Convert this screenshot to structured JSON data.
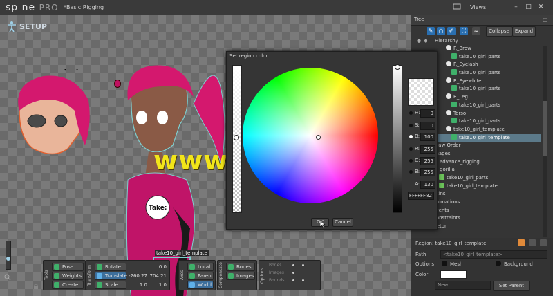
{
  "app": {
    "logo_main": "sp ne",
    "logo_pro": "PRO",
    "project": "*Basic Rigging",
    "views_label": "Views"
  },
  "viewport": {
    "mode_label": "SETUP",
    "name_tag": "take10_girl_template",
    "shirt_text": "Take:"
  },
  "tree": {
    "title": "Tree",
    "collapse_label": "Collapse",
    "expand_label": "Expand",
    "hierarchy_label": "Hierarchy",
    "rows": [
      {
        "label": "R_Brow",
        "indent": 50,
        "icon": "bone"
      },
      {
        "label": "take10_girl_parts",
        "indent": 58,
        "icon": "att"
      },
      {
        "label": "R_Eyelash",
        "indent": 50,
        "icon": "bone"
      },
      {
        "label": "take10_girl_parts",
        "indent": 58,
        "icon": "att"
      },
      {
        "label": "R_Eyewhite",
        "indent": 50,
        "icon": "bone"
      },
      {
        "label": "take10_girl_parts",
        "indent": 58,
        "icon": "att"
      },
      {
        "label": "R_Leg",
        "indent": 50,
        "icon": "bone"
      },
      {
        "label": "take10_girl_parts",
        "indent": 58,
        "icon": "att"
      },
      {
        "label": "Torso",
        "indent": 50,
        "icon": "bone"
      },
      {
        "label": "take10_girl_parts",
        "indent": 58,
        "icon": "att"
      },
      {
        "label": "take10_girl_template",
        "indent": 50,
        "icon": "bone"
      },
      {
        "label": "take10_girl_template",
        "indent": 58,
        "icon": "att",
        "selected": true
      },
      {
        "label": "Draw Order",
        "indent": 20,
        "icon": "blu"
      },
      {
        "label": "Images",
        "indent": 20,
        "icon": "folder"
      },
      {
        "label": "advance_rigging",
        "indent": 30,
        "icon": "dir"
      },
      {
        "label": "gorilla",
        "indent": 30,
        "icon": "dir"
      },
      {
        "label": "take10_girl_parts",
        "indent": 40,
        "icon": "grn"
      },
      {
        "label": "take10_girl_template",
        "indent": 40,
        "icon": "grn"
      },
      {
        "label": "Skins",
        "indent": 20,
        "icon": "blu"
      },
      {
        "label": "Animations",
        "indent": 20,
        "icon": "org"
      },
      {
        "label": "Events",
        "indent": 20,
        "icon": "org"
      },
      {
        "label": "Constraints",
        "indent": 20,
        "icon": "org"
      },
      {
        "label": "skeleton",
        "indent": 12,
        "icon": "bone"
      }
    ]
  },
  "region": {
    "title": "Region: take10_girl_template",
    "path_label": "Path",
    "path_placeholder": "<take10_girl_template>",
    "options_label": "Options",
    "mesh_label": "Mesh",
    "background_label": "Background",
    "color_label": "Color",
    "new_label": "New...",
    "set_parent_label": "Set Parent"
  },
  "bottombar": {
    "tools_label": "Tools",
    "pose": "Pose",
    "weights": "Weights",
    "create": "Create",
    "transform_label": "Transform",
    "rotate": "Rotate",
    "rotate_val": "0.0",
    "translate": "Translate",
    "translate_x": "-260.27",
    "translate_y": "704.21",
    "scale": "Scale",
    "scale_x": "1.0",
    "scale_y": "1.0",
    "axes_label": "Axes",
    "local": "Local",
    "parent": "Parent",
    "world": "World",
    "compensate_label": "Compensate",
    "bones": "Bones",
    "images": "Images",
    "options_label": "Options",
    "opt_bones": "Bones",
    "opt_images": "Images",
    "opt_bounds": "Bounds"
  },
  "dialog": {
    "title": "Set region color",
    "h_label": "H:",
    "h_val": "0",
    "s_label": "S:",
    "s_val": "0",
    "b_label": "B:",
    "b_val": "100",
    "r_label": "R:",
    "r_val": "255",
    "g_label": "G:",
    "g_val": "255",
    "bb_label": "B:",
    "bb_val": "255",
    "a_label": "A:",
    "a_val": "130",
    "hex_val": "FFFFFF82",
    "ok_label": "OK",
    "cancel_label": "Cancel"
  },
  "watermark": "www.cgtsj.com",
  "colors": {
    "accent": "#2a6fb0",
    "selection": "#5c7a8a",
    "watermark": "#f2e51a",
    "pink": "#d4186e"
  }
}
